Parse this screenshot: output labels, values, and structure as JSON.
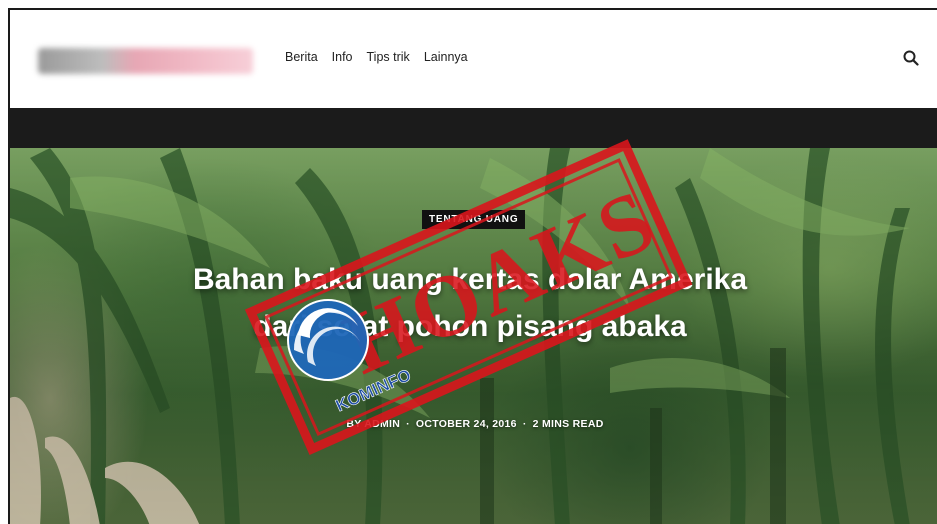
{
  "nav": {
    "items": [
      "Berita",
      "Info",
      "Tips trik",
      "Lainnya"
    ]
  },
  "article": {
    "category": "TENTANG UANG",
    "title": "Bahan baku uang kertas dolar Amerika dari serat pohon pisang abaka",
    "author": "BY ADMIN",
    "date": "OCTOBER 24, 2016",
    "read_time": "2 MINS READ"
  },
  "stamp": {
    "text": "HOAKS",
    "logo_text": "KOMINFO",
    "color": "#d9151c"
  },
  "icons": {
    "search": "search-icon"
  }
}
